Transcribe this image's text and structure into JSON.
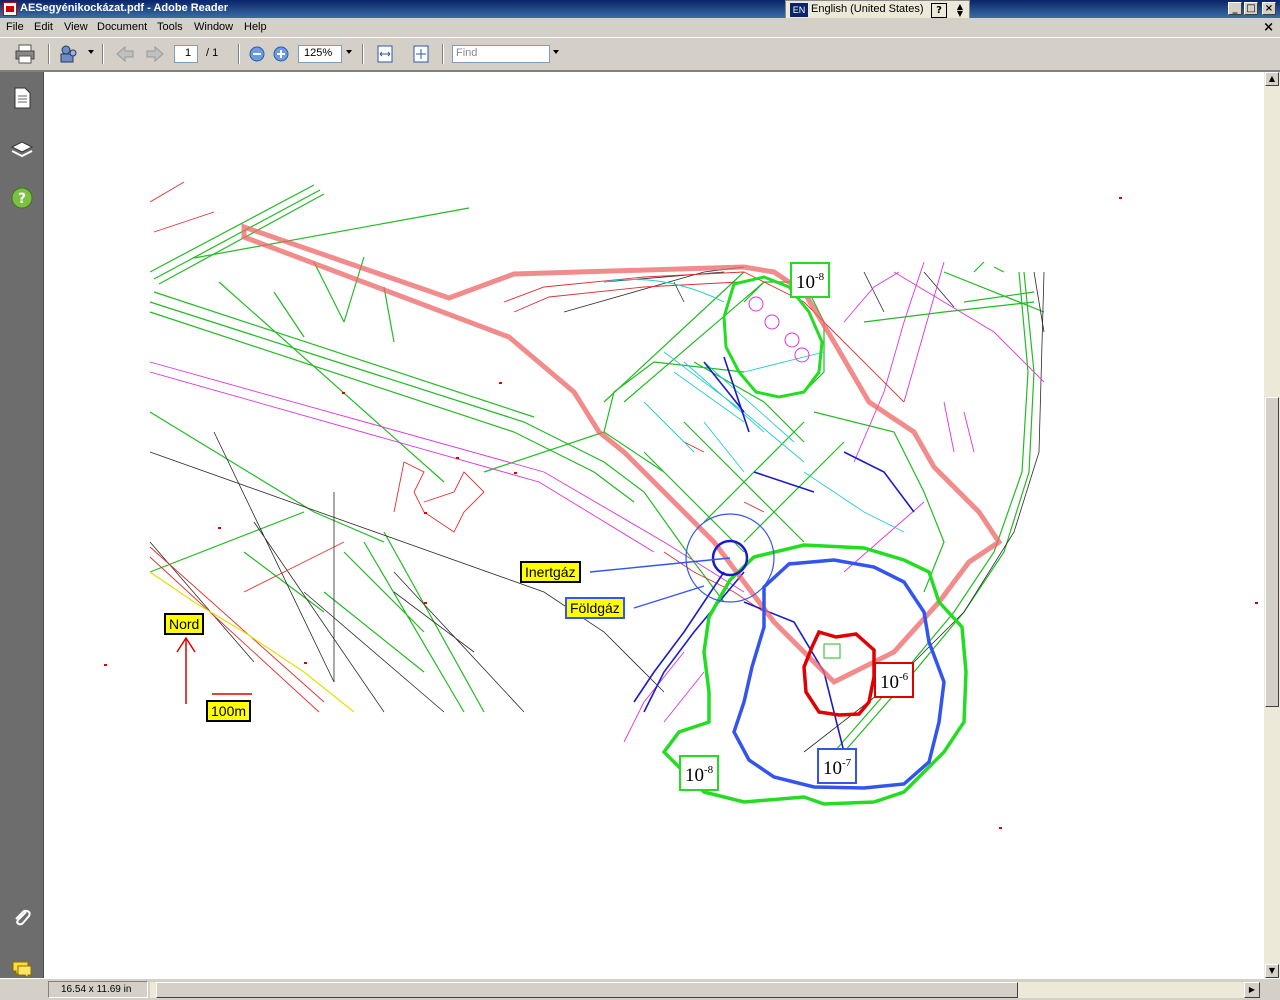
{
  "window": {
    "title": "AESegyénikockázat.pdf - Adobe Reader",
    "language_code": "EN",
    "language": "English (United States)",
    "help_symbol": "?",
    "minimize": "_",
    "maximize": "□",
    "close": "×"
  },
  "menu": {
    "items": [
      "File",
      "Edit",
      "View",
      "Document",
      "Tools",
      "Window",
      "Help"
    ],
    "close": "×"
  },
  "toolbar": {
    "current_page": "1",
    "page_total": "/ 1",
    "zoom": "125%",
    "find_placeholder": "Find"
  },
  "status": {
    "page_size": "16.54 x 11.69 in"
  },
  "map": {
    "north_label": "Nord",
    "scale_label": "100m",
    "inertgaz_label": "Inertgáz",
    "foldgaz_label": "Földgáz",
    "risk_top_green": {
      "base": "10",
      "exp": "-8"
    },
    "risk_bottom_green": {
      "base": "10",
      "exp": "-8"
    },
    "risk_red": {
      "base": "10",
      "exp": "-6"
    },
    "risk_blue": {
      "base": "10",
      "exp": "-7"
    },
    "colors": {
      "contour_1e-6": "#e00000",
      "contour_1e-7": "#3355ee",
      "contour_1e-8": "#22dd22",
      "boundary": "#e86060"
    }
  }
}
